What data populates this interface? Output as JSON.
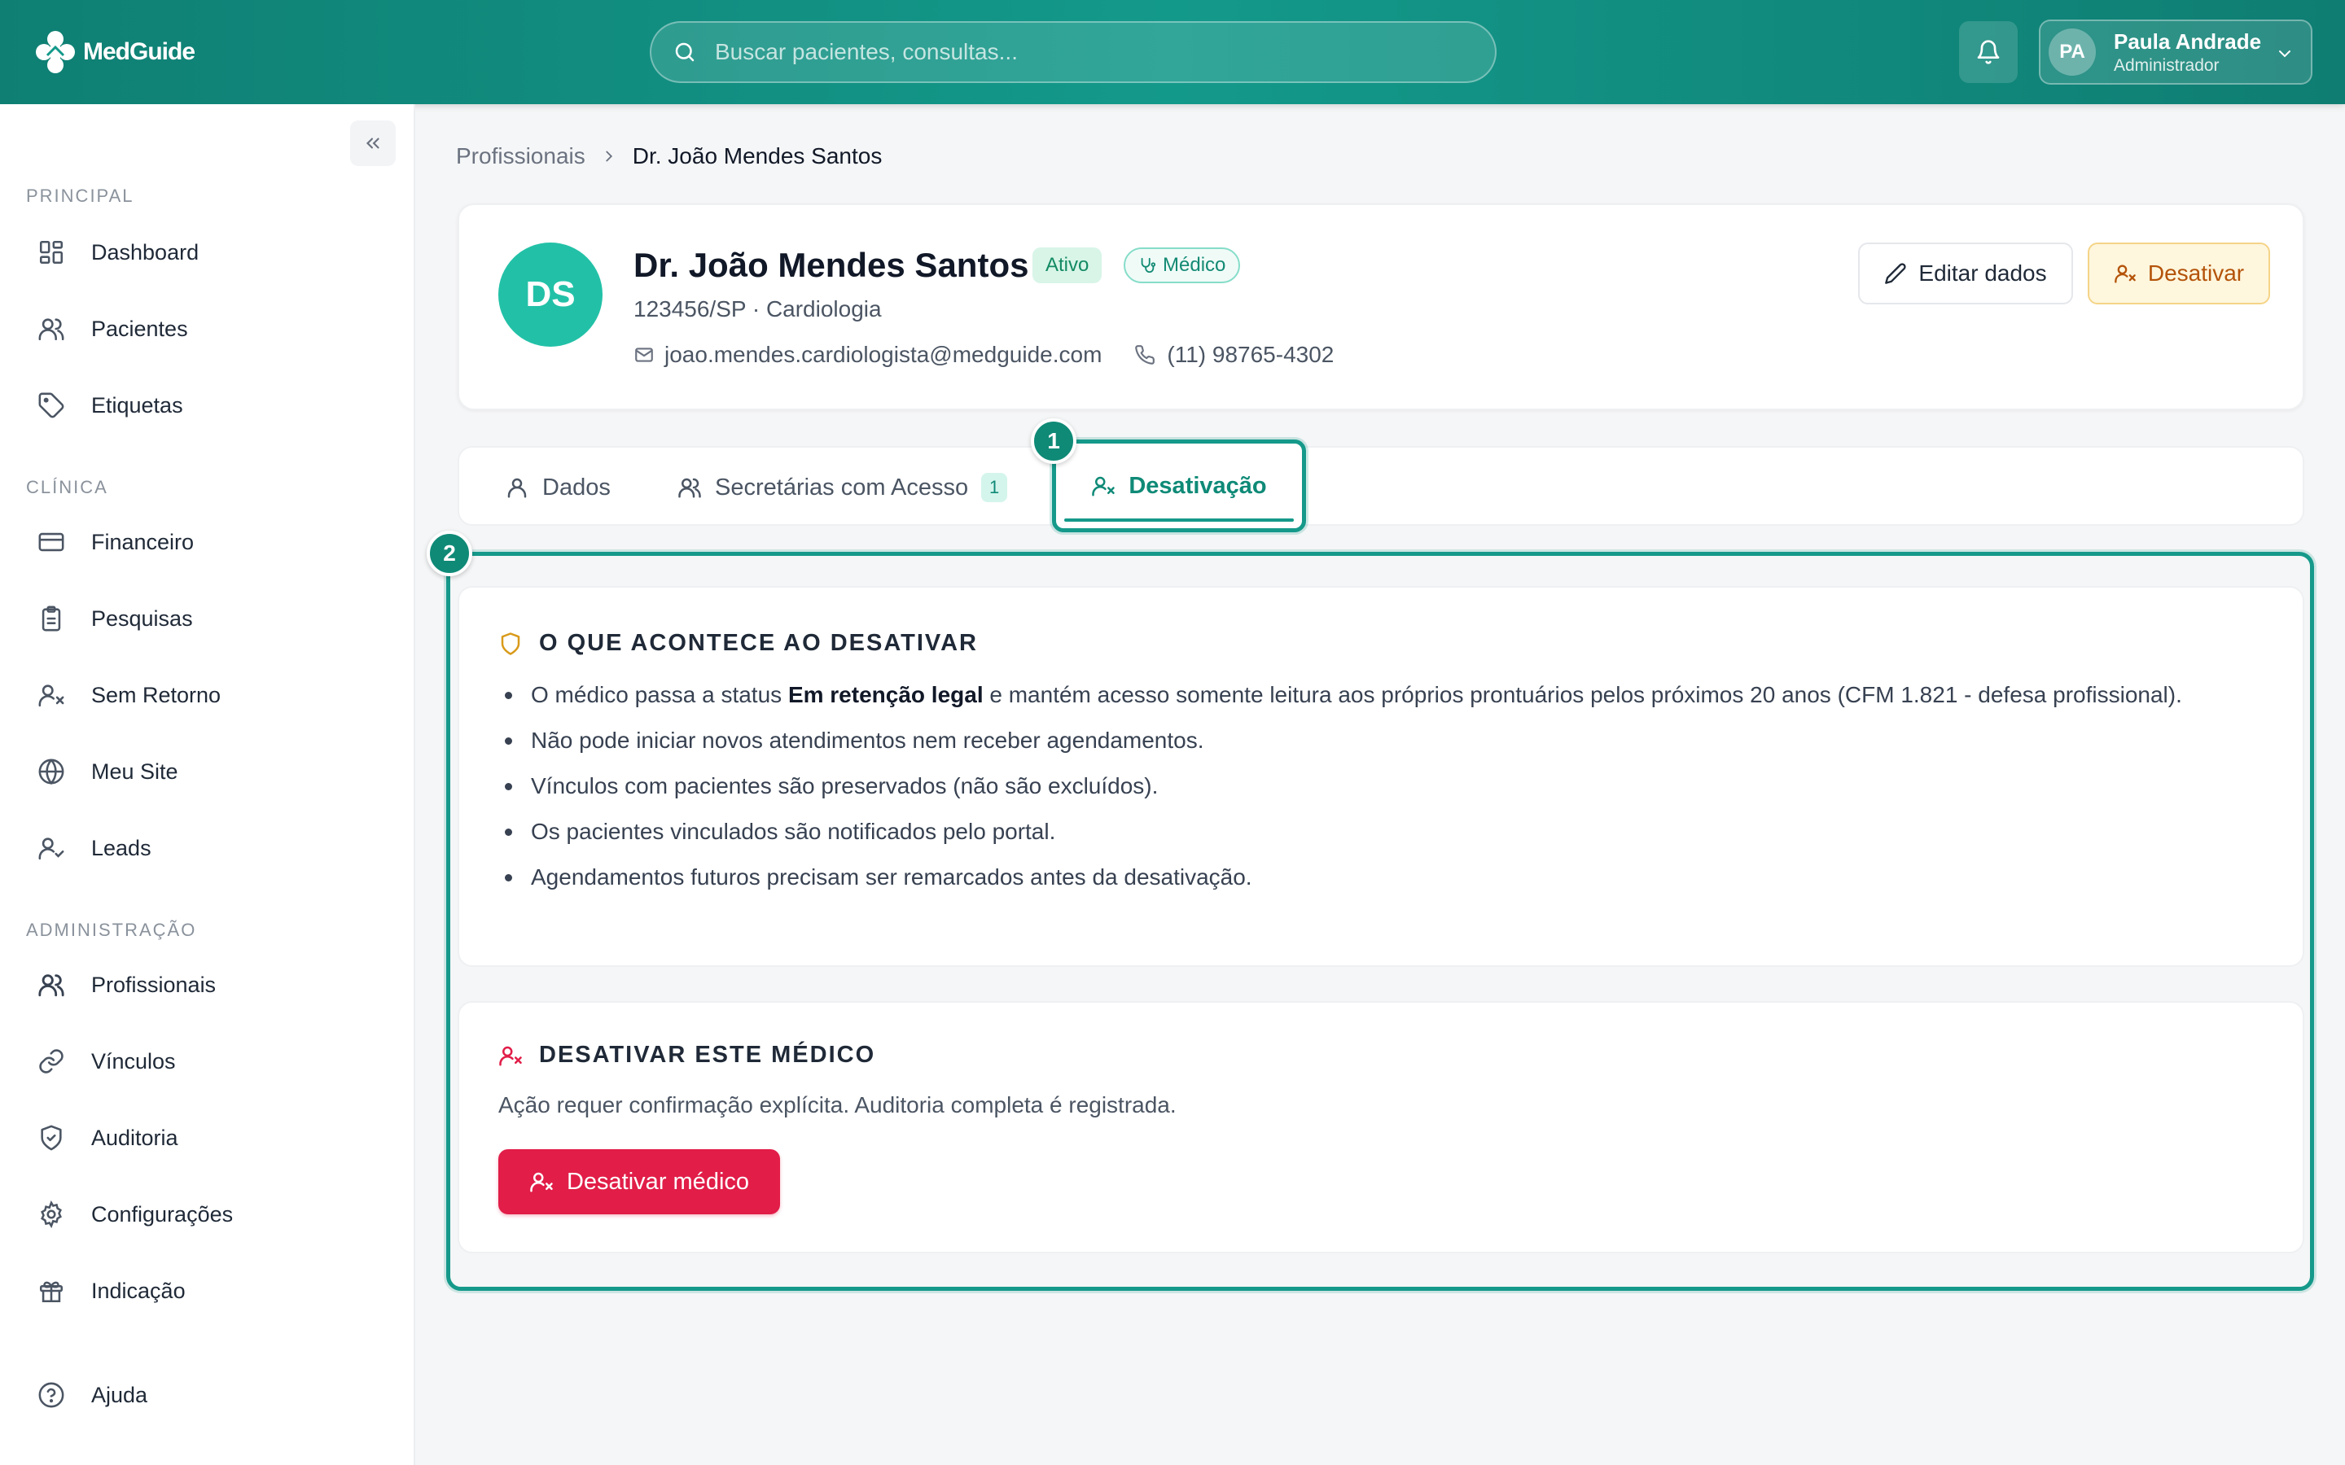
{
  "app": {
    "logo_text": "MedGuide"
  },
  "header": {
    "search_placeholder": "Buscar pacientes, consultas...",
    "user": {
      "initials": "PA",
      "name": "Paula Andrade",
      "role": "Administrador"
    }
  },
  "sidebar": {
    "sections": [
      {
        "title": "PRINCIPAL",
        "items": [
          "Dashboard",
          "Pacientes",
          "Etiquetas"
        ]
      },
      {
        "title": "CLÍNICA",
        "items": [
          "Financeiro",
          "Pesquisas",
          "Sem Retorno",
          "Meu Site",
          "Leads"
        ]
      },
      {
        "title": "ADMINISTRAÇÃO",
        "items": [
          "Profissionais",
          "Vínculos",
          "Auditoria",
          "Configurações",
          "Indicação"
        ]
      }
    ],
    "help": "Ajuda"
  },
  "breadcrumb": {
    "parent": "Profissionais",
    "current": "Dr. João Mendes Santos"
  },
  "profile": {
    "initials": "DS",
    "name": "Dr. João Mendes Santos",
    "status_badge": "Ativo",
    "role_badge": "Médico",
    "subtitle": "123456/SP · Cardiologia",
    "email": "joao.mendes.cardiologista@medguide.com",
    "phone": "(11) 98765-4302",
    "edit_label": "Editar dados",
    "deactivate_label": "Desativar"
  },
  "tabs": [
    {
      "label": "Dados"
    },
    {
      "label": "Secretárias com Acesso",
      "count": "1"
    },
    {
      "label": "Desativação"
    }
  ],
  "markers": [
    "1",
    "2"
  ],
  "info_card": {
    "title": "O QUE ACONTECE AO DESATIVAR",
    "bullet1_pre": "O médico passa a status ",
    "bullet1_bold": "Em retenção legal",
    "bullet1_post": " e mantém acesso somente leitura aos próprios prontuários pelos próximos 20 anos (CFM 1.821 - defesa profissional).",
    "bullets": [
      "Não pode iniciar novos atendimentos nem receber agendamentos.",
      "Vínculos com pacientes são preservados (não são excluídos).",
      "Os pacientes vinculados são notificados pelo portal.",
      "Agendamentos futuros precisam ser remarcados antes da desativação."
    ]
  },
  "action_card": {
    "title": "DESATIVAR ESTE MÉDICO",
    "description": "Ação requer confirmação explícita. Auditoria completa é registrada.",
    "button_label": "Desativar médico"
  },
  "colors": {
    "primary": "#15998a",
    "danger": "#e11d48",
    "warning_bg": "#fef6dd",
    "warning_text": "#b45309"
  }
}
